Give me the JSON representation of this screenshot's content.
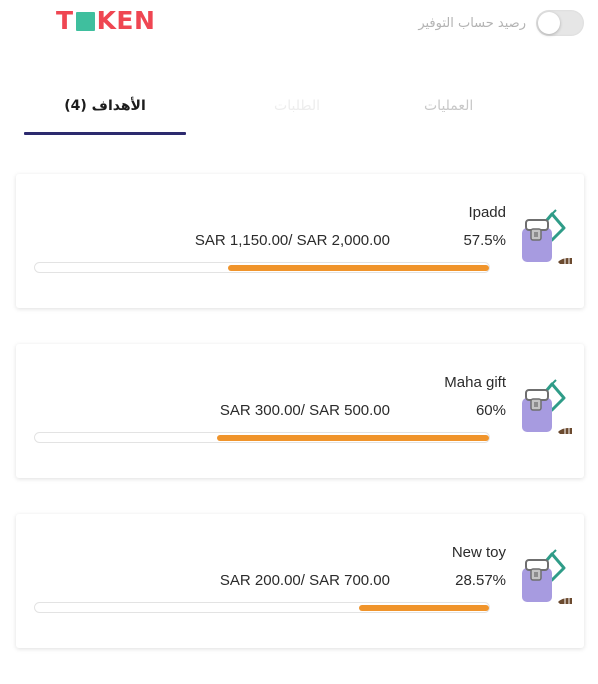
{
  "header": {
    "logo": {
      "letters_before": "T",
      "letters_after": "KEN",
      "alt": "TOKEN"
    },
    "savings_toggle": {
      "label": "رصيد حساب التوفير",
      "on": false
    }
  },
  "tabs": [
    {
      "label": "الأهداف (4)",
      "active": true
    },
    {
      "label": "الطلبات",
      "active": false
    },
    {
      "label": "العمليات",
      "active": false
    }
  ],
  "goals": [
    {
      "name": "Ipadd",
      "percent_label": "57.5%",
      "amount": "SAR 1,150.00/ SAR 2,000.00",
      "progress": 0.575
    },
    {
      "name": "Maha gift",
      "percent_label": "60%",
      "amount": "SAR 300.00/ SAR 500.00",
      "progress": 0.6
    },
    {
      "name": "New toy",
      "percent_label": "28.57%",
      "amount": "SAR 200.00/ SAR 700.00",
      "progress": 0.2857
    }
  ],
  "colors": {
    "brand_red": "#ef4652",
    "brand_green": "#3fbf9e",
    "tab_indicator": "#2c2a6e",
    "progress_fill": "#f0942b",
    "goal_icon_purple": "#a79be0",
    "goal_icon_teal": "#2f9c88"
  },
  "icons": {
    "goal": "money-jar-icon"
  }
}
